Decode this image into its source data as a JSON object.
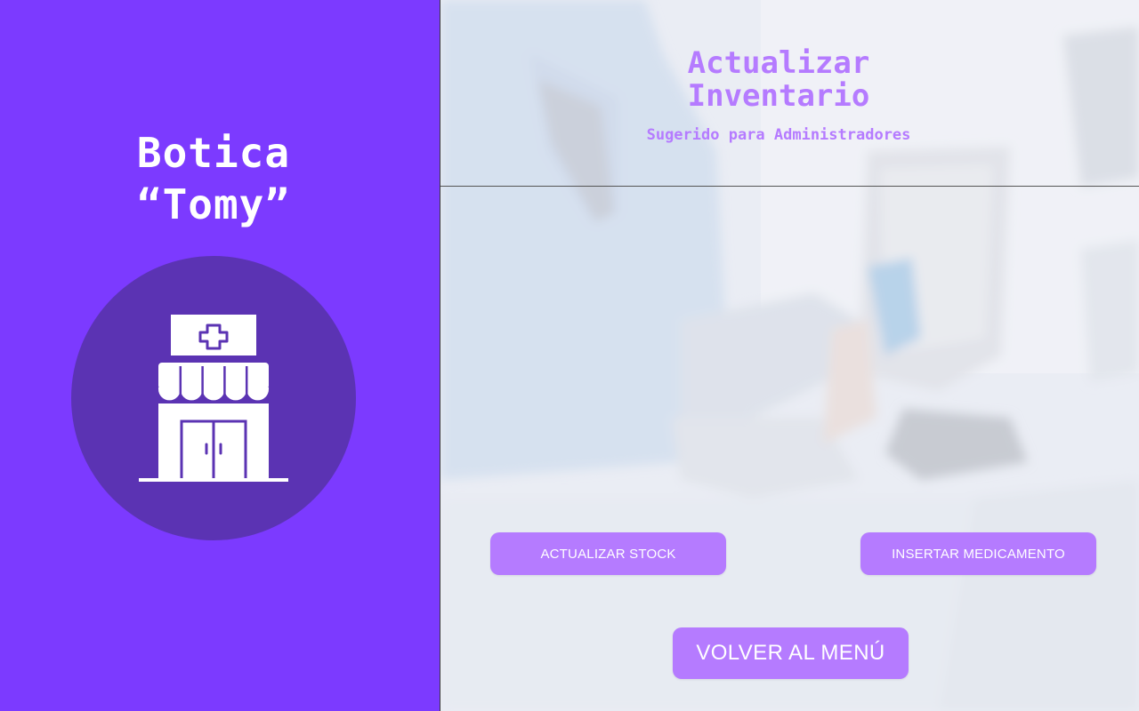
{
  "brand": {
    "line1": "Botica",
    "line2": "“Tomy”"
  },
  "logo": {
    "icon": "pharmacy-store-icon"
  },
  "header": {
    "title_line1": "Actualizar",
    "title_line2": "Inventario",
    "subtitle": "Sugerido para Administradores"
  },
  "actions": {
    "update_stock_label": "ACTUALIZAR STOCK",
    "insert_medicine_label": "INSERTAR MEDICAMENTO",
    "back_label": "VOLVER AL MENÚ"
  },
  "colors": {
    "left_panel": "#7c3aff",
    "logo_circle": "#5b33b3",
    "accent": "#b57bff"
  }
}
